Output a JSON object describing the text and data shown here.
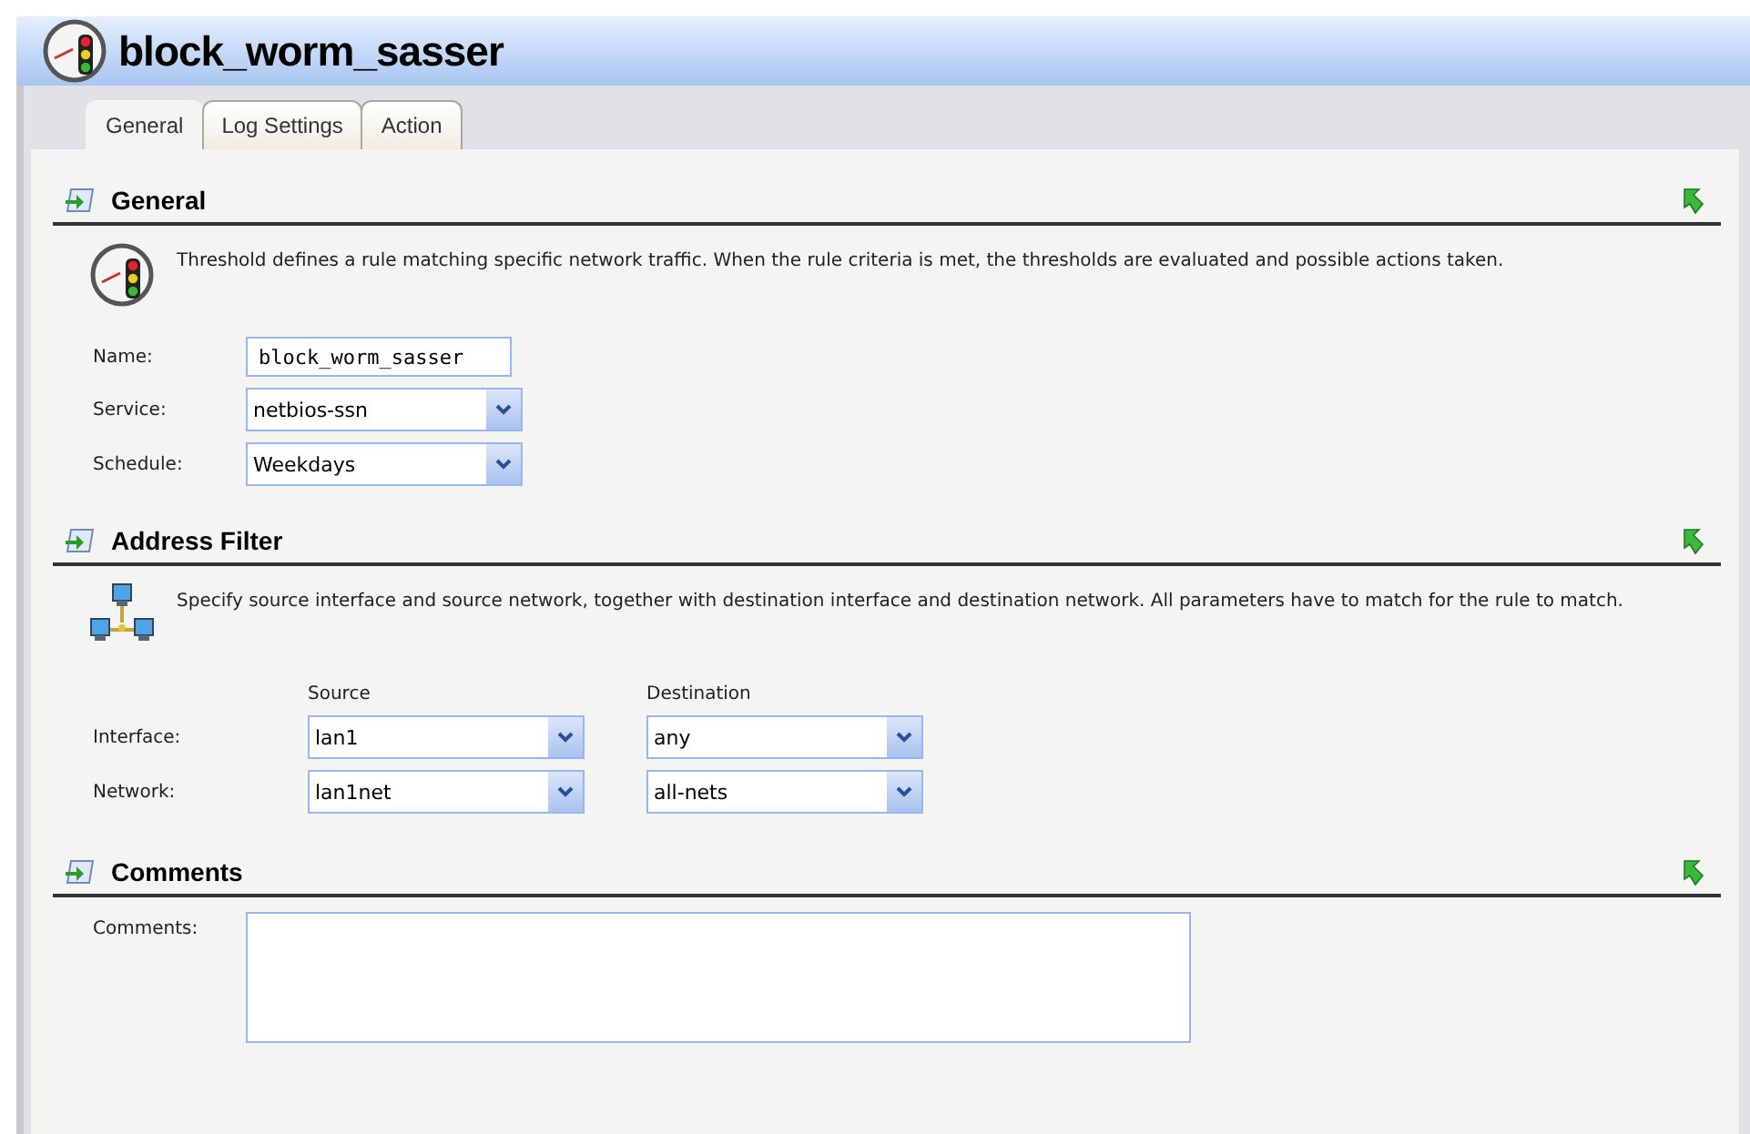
{
  "window": {
    "title": "block_worm_sasser"
  },
  "tabs": [
    {
      "label": "General",
      "selected": true
    },
    {
      "label": "Log Settings",
      "selected": false
    },
    {
      "label": "Action",
      "selected": false
    }
  ],
  "sections": [
    {
      "kind": "general",
      "title": "General",
      "description": "Threshold defines a rule matching specific network traffic. When the rule criteria is met, the thresholds are evaluated and possible actions taken.",
      "fields": [
        {
          "kind": "text",
          "label": "Name:",
          "value": "block_worm_sasser"
        },
        {
          "kind": "select",
          "label": "Service:",
          "value": "netbios-ssn"
        },
        {
          "kind": "select",
          "label": "Schedule:",
          "value": "Weekdays"
        }
      ]
    },
    {
      "kind": "address",
      "title": "Address Filter",
      "description": "Specify source interface and source network, together with destination interface and destination network. All parameters have to match for the rule to match.",
      "columns": [
        "Source",
        "Destination"
      ],
      "rows": [
        {
          "label": "Interface:",
          "source": "lan1",
          "destination": "any"
        },
        {
          "label": "Network:",
          "source": "lan1net",
          "destination": "all-nets"
        }
      ]
    },
    {
      "kind": "comments",
      "title": "Comments",
      "label": "Comments:"
    }
  ]
}
